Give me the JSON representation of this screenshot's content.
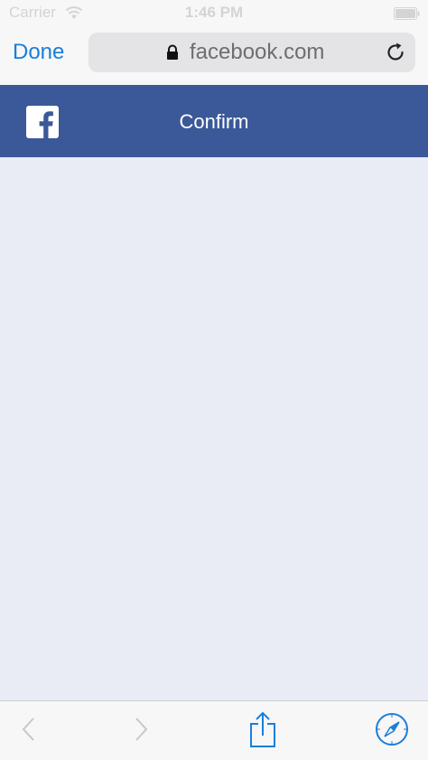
{
  "status_bar": {
    "carrier": "Carrier",
    "time": "1:46 PM"
  },
  "browser": {
    "done_label": "Done",
    "url": "facebook.com"
  },
  "fb_header": {
    "title": "Confirm"
  },
  "icons": {
    "wifi": "wifi-icon",
    "battery": "battery-icon",
    "lock": "lock-icon",
    "reload": "reload-icon",
    "facebook_logo": "facebook-logo-icon",
    "back": "chevron-left-icon",
    "forward": "chevron-right-icon",
    "share": "share-icon",
    "safari": "compass-icon"
  },
  "colors": {
    "accent": "#1b7ed9",
    "facebook_blue": "#3b5998",
    "content_bg": "#e9ebf5",
    "disabled": "#c7c7cc"
  }
}
